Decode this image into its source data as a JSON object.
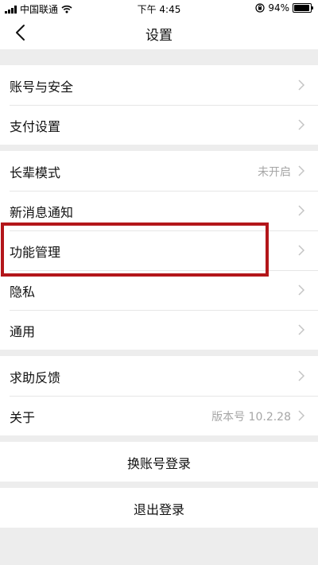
{
  "status_bar": {
    "carrier": "中国联通",
    "time": "下午 4:45",
    "battery_percent": "94%",
    "battery_level": 0.94
  },
  "nav": {
    "title": "设置"
  },
  "groups": [
    {
      "items": [
        {
          "label": "账号与安全",
          "value": ""
        },
        {
          "label": "支付设置",
          "value": ""
        }
      ]
    },
    {
      "items": [
        {
          "label": "长辈模式",
          "value": "未开启"
        },
        {
          "label": "新消息通知",
          "value": ""
        },
        {
          "label": "功能管理",
          "value": ""
        },
        {
          "label": "隐私",
          "value": ""
        },
        {
          "label": "通用",
          "value": ""
        }
      ]
    },
    {
      "items": [
        {
          "label": "求助反馈",
          "value": ""
        },
        {
          "label": "关于",
          "value": "版本号 10.2.28"
        }
      ]
    }
  ],
  "actions": {
    "switch_account": "换账号登录",
    "logout": "退出登录"
  },
  "highlight_color": "#b3161a"
}
